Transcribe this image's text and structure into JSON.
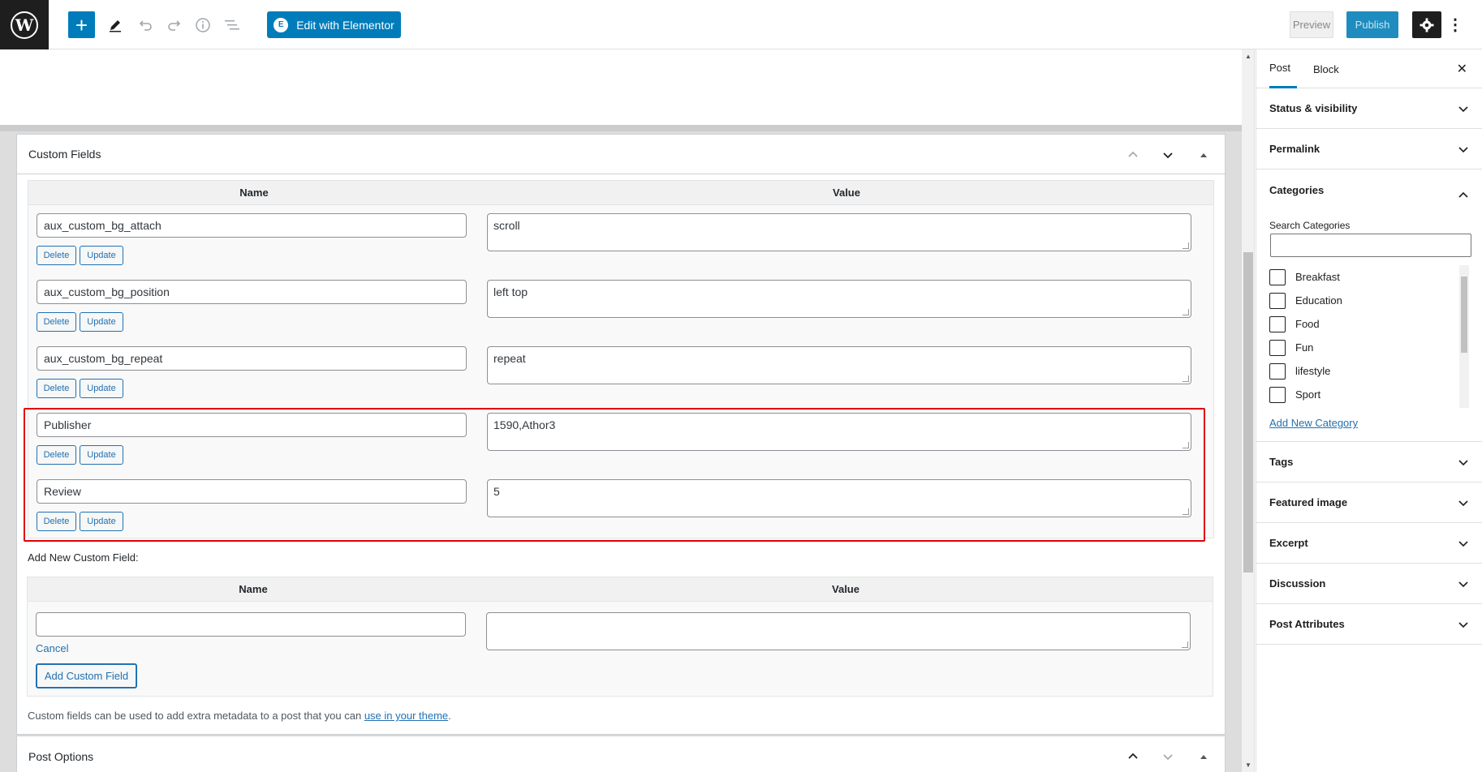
{
  "toolbar": {
    "elementor_label": "Edit with Elementor",
    "preview_label": "Preview",
    "publish_label": "Publish"
  },
  "custom_fields": {
    "title": "Custom Fields",
    "col_name": "Name",
    "col_value": "Value",
    "delete_label": "Delete",
    "update_label": "Update",
    "rows": [
      {
        "name": "aux_custom_bg_attach",
        "value": "scroll"
      },
      {
        "name": "aux_custom_bg_position",
        "value": "left top"
      },
      {
        "name": "aux_custom_bg_repeat",
        "value": "repeat"
      },
      {
        "name": "Publisher",
        "value": "1590,Athor3"
      },
      {
        "name": "Review",
        "value": "5"
      }
    ],
    "add_new_label": "Add New Custom Field:",
    "cancel_label": "Cancel",
    "add_button_label": "Add Custom Field",
    "help_text": "Custom fields can be used to add extra metadata to a post that you can ",
    "help_link": "use in your theme",
    "help_end": "."
  },
  "post_options": {
    "title": "Post Options"
  },
  "sidebar": {
    "tab_post": "Post",
    "tab_block": "Block",
    "panels_top": [
      "Status & visibility",
      "Permalink"
    ],
    "categories_title": "Categories",
    "search_categories_label": "Search Categories",
    "categories": [
      "Breakfast",
      "Education",
      "Food",
      "Fun",
      "lifestyle",
      "Sport"
    ],
    "add_category_label": "Add New Category",
    "panels_bottom": [
      "Tags",
      "Featured image",
      "Excerpt",
      "Discussion",
      "Post Attributes"
    ]
  }
}
